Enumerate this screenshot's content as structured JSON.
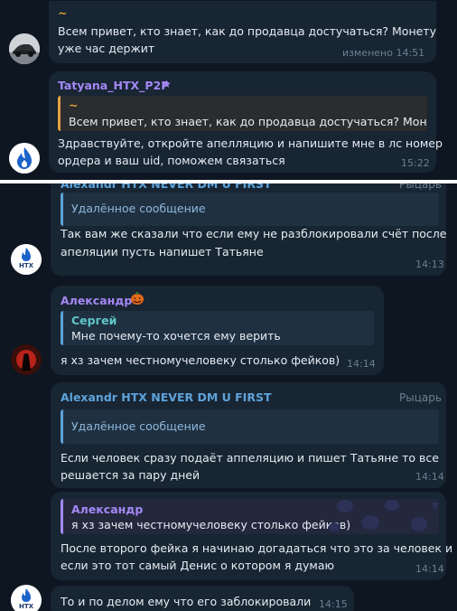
{
  "colors": {
    "background": "#0e1621",
    "bubble": "#182533",
    "quote_bg": "#1f3041",
    "accent_blue": "#5ea3db",
    "name_purple": "#a488f5",
    "name_teal": "#5fc7c7",
    "quote_orange": "#e4a242",
    "time_gray": "#6d7f8f"
  },
  "top": {
    "msg1": {
      "sender": "~",
      "text_lines": [
        "Всем привет, кто знает, как до продавца достучаться? Монету",
        "уже час держит"
      ],
      "edited_time": "изменено 14:51"
    },
    "msg2": {
      "sender": "Tatyana_HTX_P2P",
      "badge_icon": "star-icon",
      "quote_name": "~",
      "quote_text": "Всем привет, кто знает, как до продавца достучаться? Монет...",
      "text_lines": [
        "Здравствуйте, откройте апелляцию и напишите мне в лс номер",
        "ордера и ваш uid, поможем связаться"
      ],
      "time": "15:22"
    }
  },
  "bottom": {
    "msg1": {
      "sender": "Alexandr HTX NEVER DM U FIRST",
      "rank": "Рыцарь",
      "quote_text": "Удалённое сообщение",
      "text_lines": [
        "Так вам же сказали что если ему не разблокировали счёт после",
        "апеляции пусть напишет Татьяне"
      ],
      "time": "14:13"
    },
    "msg2": {
      "sender": "Александр",
      "sender_icon": "pumpkin-icon",
      "quote_name": "Сергей",
      "quote_text": "Мне почему-то хочется ему верить",
      "text": "я хз зачем честномучеловеку столько фейков)",
      "time": "14:14"
    },
    "msg3": {
      "sender": "Alexandr HTX NEVER DM U FIRST",
      "rank": "Рыцарь",
      "quote_text": "Удалённое сообщение",
      "text_lines": [
        "Если человек сразу подаёт аппеляцию и пишет Татьяне то все",
        "решается за пару дней"
      ],
      "time": "14:14"
    },
    "msg4": {
      "quote_name": "Александр",
      "quote_text": "я хз зачем честномучеловеку столько фейков)",
      "text_lines": [
        "После второго фейка я начинаю догадаться что это за человек и",
        "если это тот самый Денис о котором я думаю"
      ],
      "time": "14:14"
    },
    "msg5": {
      "text": "То и по делом ему что его заблокировали",
      "time": "14:15"
    },
    "htx_avatar_text": "HTX"
  }
}
